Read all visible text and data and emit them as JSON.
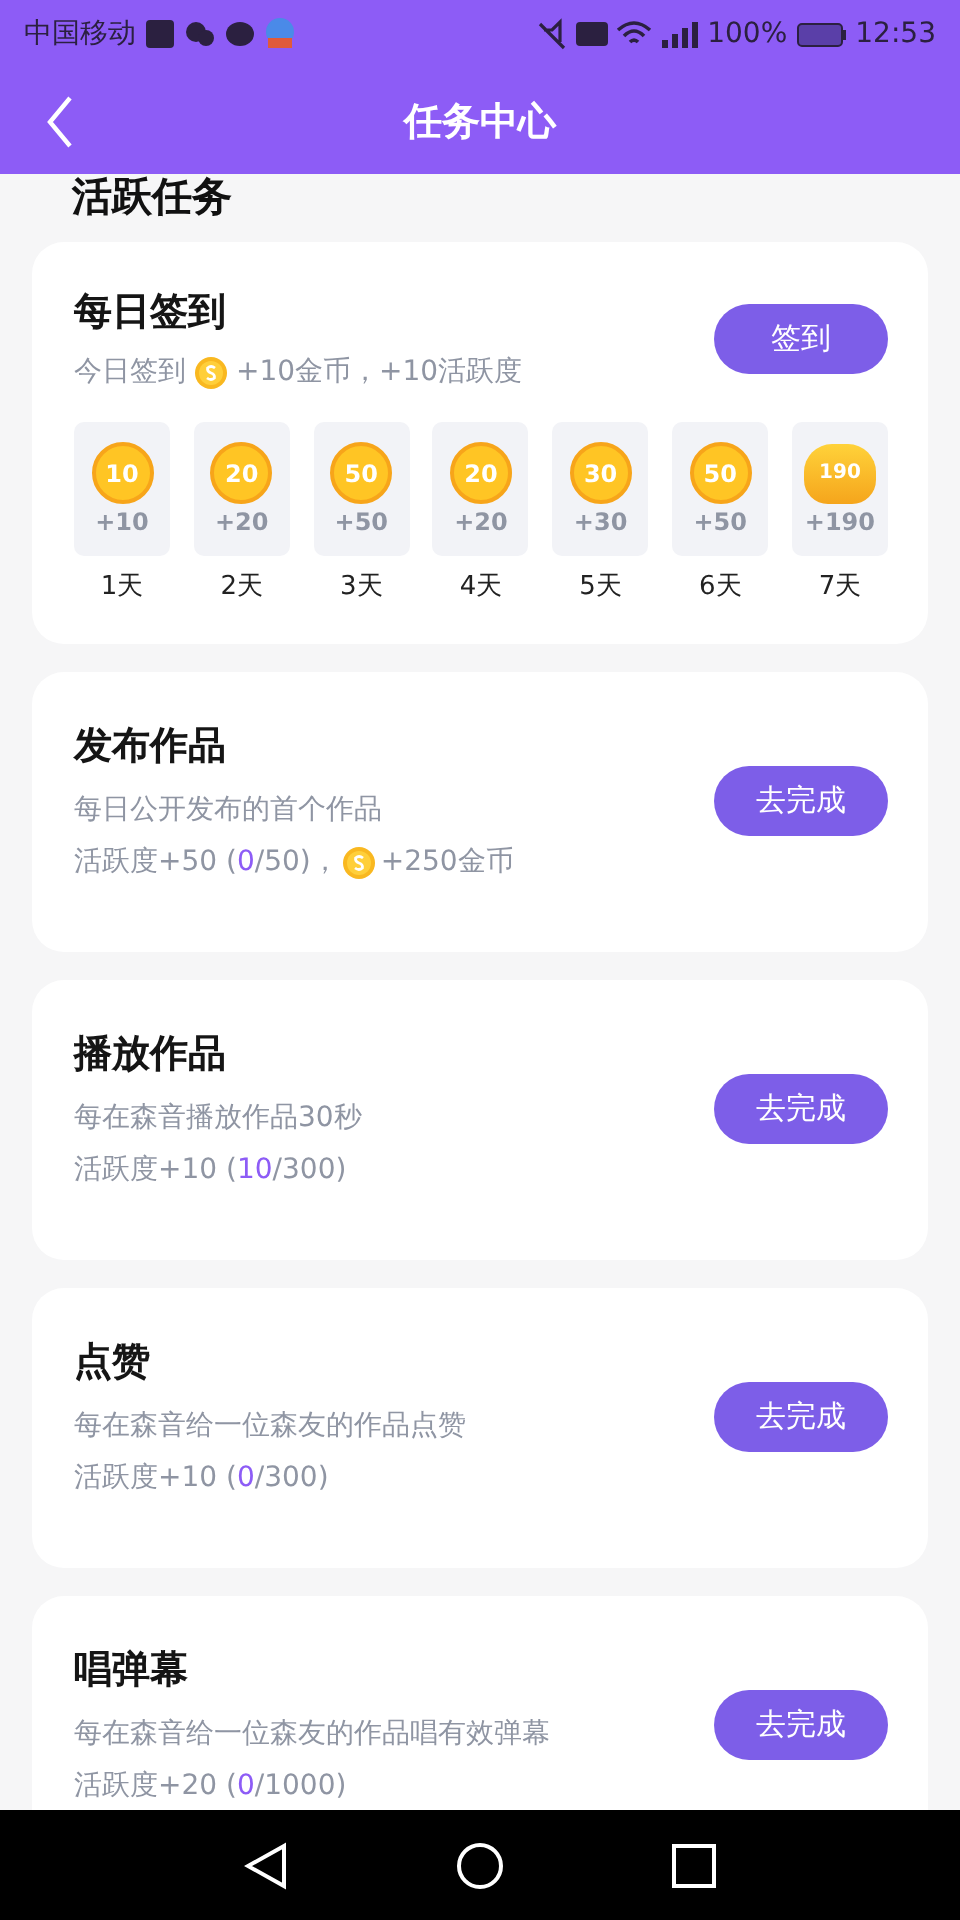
{
  "status_bar": {
    "carrier": "中国移动",
    "battery_text": "100%",
    "time": "12:53"
  },
  "header": {
    "title": "任务中心"
  },
  "section_title": "活跃任务",
  "sign_in": {
    "title": "每日签到",
    "subtitle_before": "今日签到",
    "subtitle_after": "+10金币，+10活跃度",
    "button": "签到",
    "days": [
      {
        "kind": "coin",
        "value": "10",
        "reward": "+10",
        "label": "1天"
      },
      {
        "kind": "coin",
        "value": "20",
        "reward": "+20",
        "label": "2天"
      },
      {
        "kind": "coin",
        "value": "50",
        "reward": "+50",
        "label": "3天"
      },
      {
        "kind": "coin",
        "value": "20",
        "reward": "+20",
        "label": "4天"
      },
      {
        "kind": "coin",
        "value": "30",
        "reward": "+30",
        "label": "5天"
      },
      {
        "kind": "coin",
        "value": "50",
        "reward": "+50",
        "label": "6天"
      },
      {
        "kind": "bag",
        "value": "190",
        "reward": "+190",
        "label": "7天"
      }
    ]
  },
  "tasks": [
    {
      "title": "发布作品",
      "description": "每日公开发布的首个作品",
      "progress_before": "活跃度+50 (",
      "progress_current": "0",
      "progress_after": "/50)，",
      "coin_reward": "+250金币",
      "button": "去完成"
    },
    {
      "title": "播放作品",
      "description": "每在森音播放作品30秒",
      "progress_before": "活跃度+10 (",
      "progress_current": "10",
      "progress_after": "/300)",
      "button": "去完成"
    },
    {
      "title": "点赞",
      "description": "每在森音给一位森友的作品点赞",
      "progress_before": "活跃度+10 (",
      "progress_current": "0",
      "progress_after": "/300)",
      "button": "去完成"
    },
    {
      "title": "唱弹幕",
      "description": "每在森音给一位森友的作品唱有效弹幕",
      "progress_before": "活跃度+20 (",
      "progress_current": "0",
      "progress_after": "/1000)",
      "button": "去完成"
    }
  ]
}
